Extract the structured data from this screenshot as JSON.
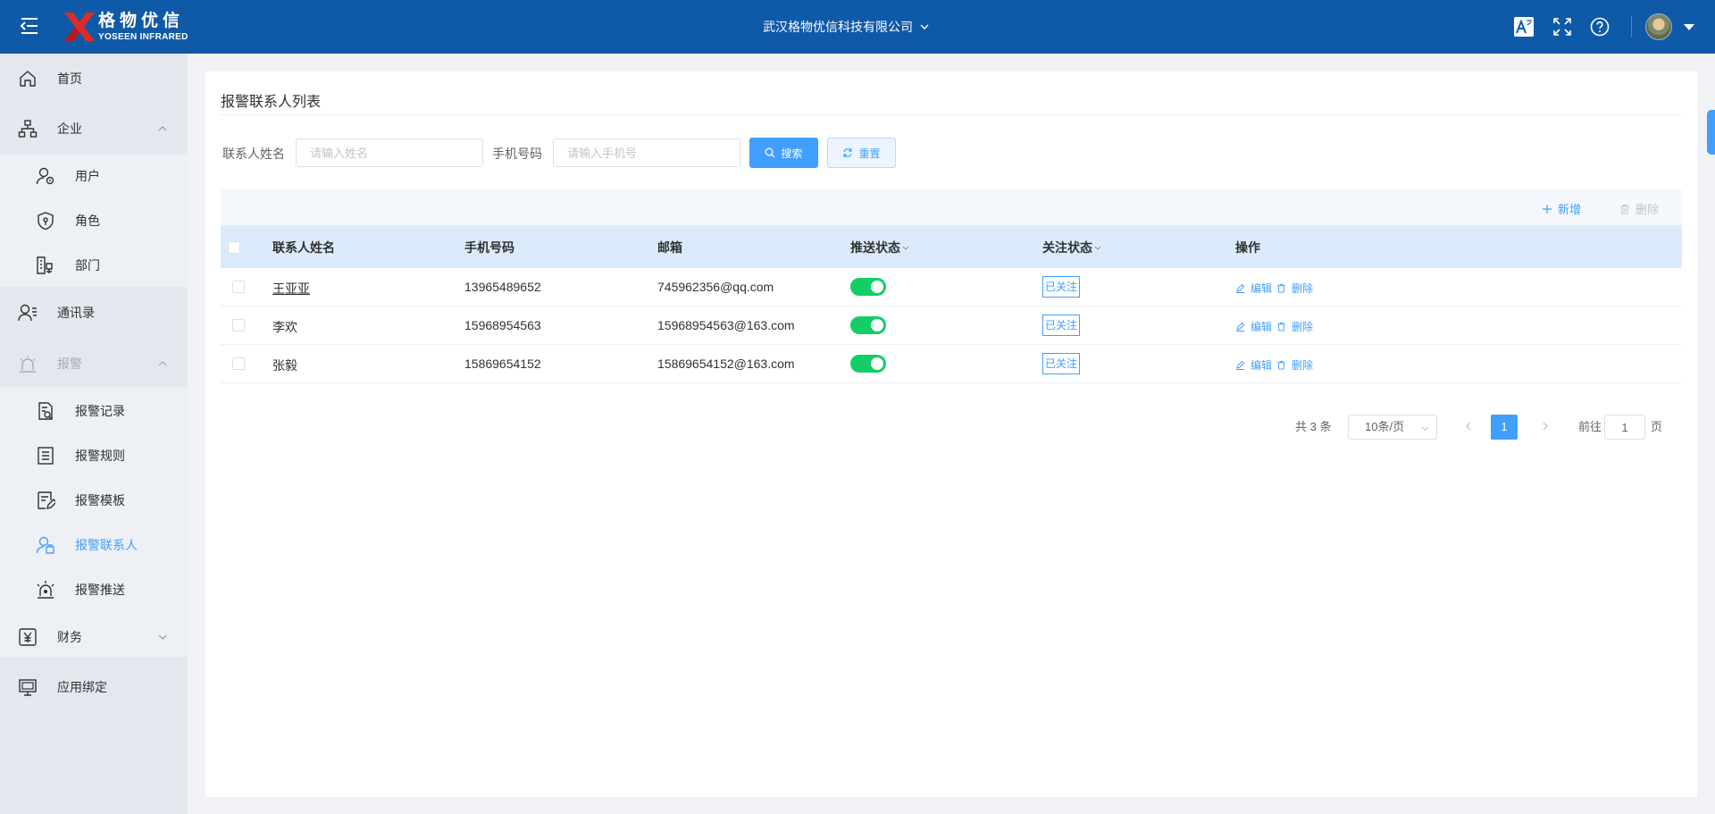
{
  "header": {
    "logo_cn": "格物优信",
    "logo_en": "YOSEEN INFRARED",
    "company": "武汉格物优信科技有限公司",
    "icons": [
      "translate-icon",
      "fullscreen-icon",
      "help-icon"
    ]
  },
  "sidebar": {
    "items": [
      {
        "label": "首页",
        "icon": "home-icon"
      },
      {
        "label": "企业",
        "icon": "org-chart-icon"
      },
      {
        "label": "用户",
        "icon": "user-settings-icon"
      },
      {
        "label": "角色",
        "icon": "shield-icon"
      },
      {
        "label": "部门",
        "icon": "department-icon"
      },
      {
        "label": "通讯录",
        "icon": "contacts-icon"
      },
      {
        "label": "报警",
        "icon": "alarm-icon"
      },
      {
        "label": "报警记录",
        "icon": "alarm-record-icon"
      },
      {
        "label": "报警规则",
        "icon": "alarm-rule-icon"
      },
      {
        "label": "报警模板",
        "icon": "alarm-template-icon"
      },
      {
        "label": "报警联系人",
        "icon": "alarm-contact-icon"
      },
      {
        "label": "报警推送",
        "icon": "alarm-push-icon"
      },
      {
        "label": "财务",
        "icon": "finance-icon"
      },
      {
        "label": "应用绑定",
        "icon": "app-bind-icon"
      }
    ]
  },
  "page": {
    "title": "报警联系人列表"
  },
  "search": {
    "name_label": "联系人姓名",
    "name_placeholder": "请输入姓名",
    "phone_label": "手机号码",
    "phone_placeholder": "请输入手机号",
    "search_button": "搜索",
    "reset_button": "重置"
  },
  "toolbar": {
    "add_label": "新增",
    "delete_label": "删除"
  },
  "table": {
    "columns": [
      "联系人姓名",
      "手机号码",
      "邮箱",
      "推送状态",
      "关注状态",
      "操作"
    ],
    "rows": [
      {
        "name": "王亚亚",
        "phone": "13965489652",
        "email": "745962356@qq.com",
        "push_on": true,
        "follow": "已关注",
        "edit": "编辑",
        "delete": "删除"
      },
      {
        "name": "李欢",
        "phone": "15968954563",
        "email": "15968954563@163.com",
        "push_on": true,
        "follow": "已关注",
        "edit": "编辑",
        "delete": "删除"
      },
      {
        "name": "张毅",
        "phone": "15869654152",
        "email": "15869654152@163.com",
        "push_on": true,
        "follow": "已关注",
        "edit": "编辑",
        "delete": "删除"
      }
    ]
  },
  "pagination": {
    "total": "共 3 条",
    "page_size": "10条/页",
    "current_page": "1",
    "goto_label": "前往",
    "goto_value": "1",
    "goto_unit": "页"
  },
  "colors": {
    "header_bg": "#0f5aa8",
    "primary": "#409eff",
    "switch_on": "#13ce66",
    "sidebar_bg": "#e4e7ee"
  }
}
